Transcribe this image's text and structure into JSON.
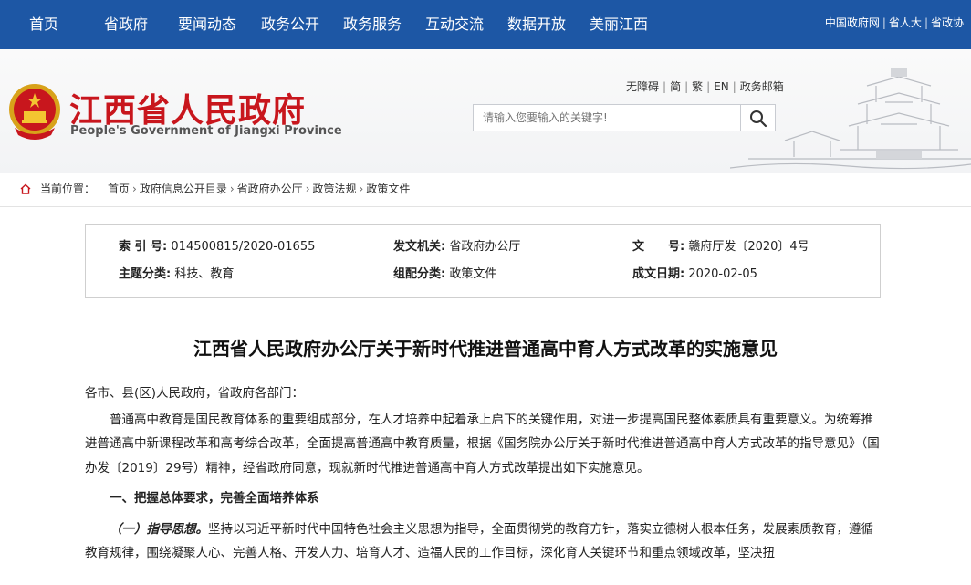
{
  "nav": {
    "items": [
      "首页",
      "省政府",
      "要闻动态",
      "政务公开",
      "政务服务",
      "互动交流",
      "数据开放",
      "美丽江西"
    ],
    "top_links": [
      "中国政府网",
      "省人大",
      "省政协"
    ]
  },
  "header": {
    "title": "江西省人民政府",
    "subtitle": "People's Government of Jiangxi Province",
    "util_links": [
      "无障碍",
      "简",
      "繁",
      "EN",
      "政务邮箱"
    ],
    "search_placeholder": "请输入您要输入的关键字!"
  },
  "breadcrumb": {
    "label": "当前位置：",
    "items": [
      "首页",
      "政府信息公开目录",
      "省政府办公厅",
      "政策法规",
      "政策文件"
    ]
  },
  "meta": {
    "index_label": "索 引 号:",
    "index_value": "014500815/2020-01655",
    "issuer_label": "发文机关:",
    "issuer_value": "省政府办公厅",
    "docno_label": "文　　号:",
    "docno_value": "赣府厅发〔2020〕4号",
    "topic_label": "主题分类:",
    "topic_value": "科技、教育",
    "group_label": "组配分类:",
    "group_value": "政策文件",
    "date_label": "成文日期:",
    "date_value": "2020-02-05"
  },
  "document": {
    "title": "江西省人民政府办公厅关于新时代推进普通高中育人方式改革的实施意见",
    "salutation": "各市、县(区)人民政府，省政府各部门：",
    "intro": "普通高中教育是国民教育体系的重要组成部分，在人才培养中起着承上启下的关键作用，对进一步提高国民整体素质具有重要意义。为统筹推进普通高中新课程改革和高考综合改革，全面提高普通高中教育质量，根据《国务院办公厅关于新时代推进普通高中育人方式改革的指导意见》（国办发〔2019〕29号）精神，经省政府同意，现就新时代推进普通高中育人方式改革提出如下实施意见。",
    "section1_heading": "一、把握总体要求，完善全面培养体系",
    "sub1_label": "（一）指导思想。",
    "sub1_text": "坚持以习近平新时代中国特色社会主义思想为指导，全面贯彻党的教育方针，落实立德树人根本任务，发展素质教育，遵循教育规律，围绕凝聚人心、完善人格、开发人力、培育人才、造福人民的工作目标，深化育人关键环节和重点领域改革，坚决扭"
  }
}
